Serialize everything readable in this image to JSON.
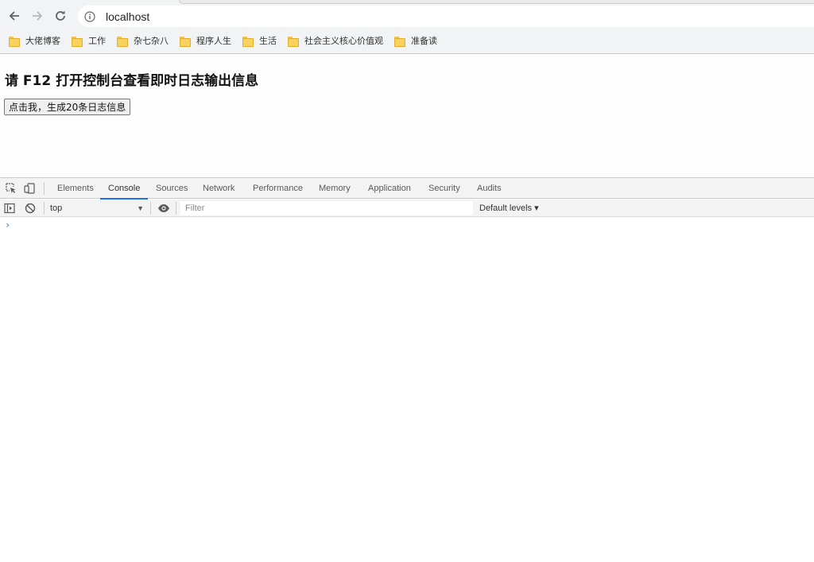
{
  "browser": {
    "url": "localhost",
    "nav": {
      "back_icon": "arrow-left-icon",
      "forward_icon": "arrow-right-icon",
      "reload_icon": "reload-icon",
      "info_icon": "info-icon"
    },
    "bookmarks": [
      {
        "label": "大佬博客"
      },
      {
        "label": "工作"
      },
      {
        "label": "杂七杂八"
      },
      {
        "label": "程序人生"
      },
      {
        "label": "生活"
      },
      {
        "label": "社会主义核心价值观"
      },
      {
        "label": "准备读"
      }
    ]
  },
  "page": {
    "heading": "请 F12 打开控制台查看即时日志输出信息",
    "button_label": "点击我，生成20条日志信息"
  },
  "devtools": {
    "tabs": [
      {
        "label": "Elements"
      },
      {
        "label": "Console",
        "active": true
      },
      {
        "label": "Sources"
      },
      {
        "label": "Network"
      },
      {
        "label": "Performance"
      },
      {
        "label": "Memory"
      },
      {
        "label": "Application"
      },
      {
        "label": "Security"
      },
      {
        "label": "Audits"
      }
    ],
    "toolbar": {
      "context": "top",
      "filter_placeholder": "Filter",
      "levels": "Default levels ▾"
    },
    "prompt_symbol": "›",
    "accent_color": "#1a73e8"
  }
}
